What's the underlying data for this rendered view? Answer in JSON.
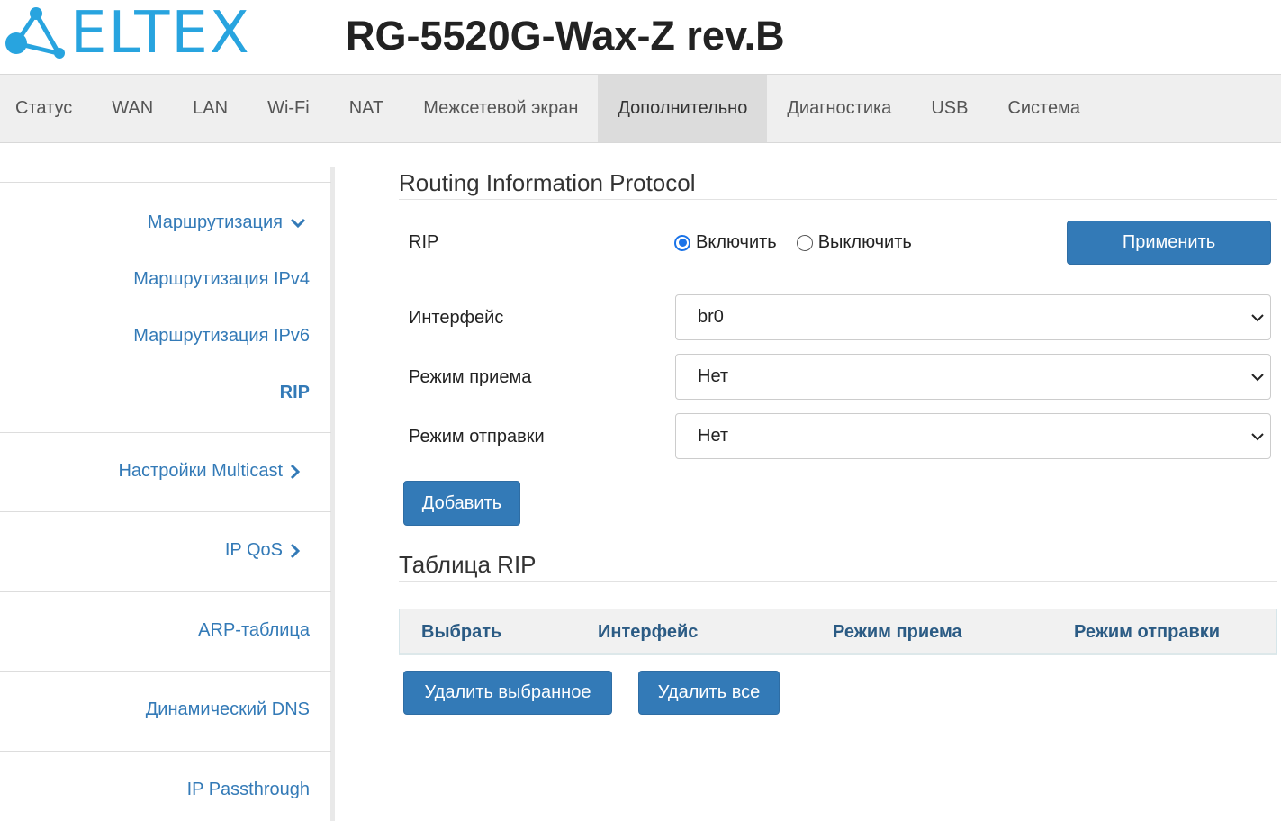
{
  "header": {
    "brand": "ELTEX",
    "model": "RG-5520G-Wax-Z rev.B",
    "brand_color": "#28a4df"
  },
  "nav": {
    "items": [
      {
        "label": "Статус"
      },
      {
        "label": "WAN"
      },
      {
        "label": "LAN"
      },
      {
        "label": "Wi-Fi"
      },
      {
        "label": "NAT"
      },
      {
        "label": "Межсетевой экран"
      },
      {
        "label": "Дополнительно",
        "active": true
      },
      {
        "label": "Диагностика"
      },
      {
        "label": "USB"
      },
      {
        "label": "Система"
      }
    ]
  },
  "sidebar": {
    "routing_group": {
      "label": "Маршрутизация",
      "icon": "chevron-down-icon",
      "items": [
        {
          "label": "Маршрутизация IPv4"
        },
        {
          "label": "Маршрутизация IPv6"
        },
        {
          "label": "RIP",
          "active": true
        }
      ]
    },
    "multicast": {
      "label": "Настройки Multicast",
      "icon": "chevron-right-icon"
    },
    "ipqos": {
      "label": "IP QoS",
      "icon": "chevron-right-icon"
    },
    "arp": {
      "label": "ARP-таблица"
    },
    "ddns": {
      "label": "Динамический DNS"
    },
    "passthrough": {
      "label": "IP Passthrough"
    }
  },
  "main": {
    "title": "Routing Information Protocol",
    "rip": {
      "label": "RIP",
      "enable_label": "Включить",
      "disable_label": "Выключить",
      "selected": "enable",
      "apply_label": "Применить"
    },
    "interface": {
      "label": "Интерфейс",
      "value": "br0"
    },
    "receive_mode": {
      "label": "Режим приема",
      "value": "Нет"
    },
    "send_mode": {
      "label": "Режим отправки",
      "value": "Нет"
    },
    "add_label": "Добавить",
    "table": {
      "title": "Таблица RIP",
      "columns": [
        "Выбрать",
        "Интерфейс",
        "Режим приема",
        "Режим отправки"
      ],
      "rows": []
    },
    "delete_selected_label": "Удалить выбранное",
    "delete_all_label": "Удалить все",
    "accent_color": "#337ab7"
  }
}
